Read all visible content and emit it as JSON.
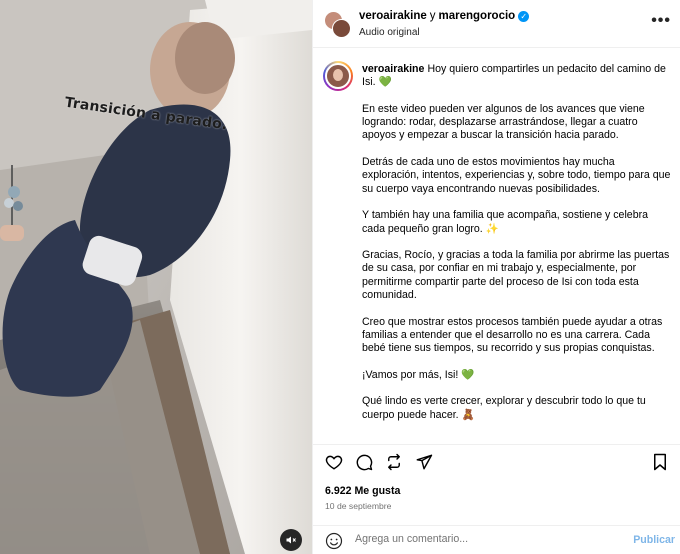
{
  "media": {
    "overlay_text": "Transición a parado."
  },
  "header": {
    "user1": "veroairakine",
    "conjunction": "y",
    "user2": "marengorocio",
    "audio": "Audio original",
    "more": "•••"
  },
  "caption": {
    "username": "veroairakine",
    "paragraphs": [
      "Hoy quiero compartirles un pedacito del camino de Isi. 💚",
      "En este video pueden ver algunos de los avances que viene logrando: rodar, desplazarse arrastrándose, llegar a cuatro apoyos y empezar a buscar la transición hacia parado.",
      "Detrás de cada uno de estos movimientos hay mucha exploración, intentos, experiencias y, sobre todo, tiempo para que su cuerpo vaya encontrando nuevas posibilidades.",
      "Y también hay una familia que acompaña, sostiene y celebra cada pequeño gran logro. ✨",
      "Gracias, Rocío, y gracias a toda la familia por abrirme las puertas de su casa, por confiar en mi trabajo y, especialmente, por permitirme compartir parte del proceso de Isi con toda esta comunidad.",
      "Creo que mostrar estos procesos también puede ayudar a otras familias a entender que el desarrollo no es una carrera. Cada bebé tiene sus tiempos, su recorrido y sus propias conquistas.",
      "¡Vamos por más, Isi! 💚",
      "Qué lindo es verte crecer, explorar y descubrir todo lo que tu cuerpo puede hacer. 🧸"
    ]
  },
  "stats": {
    "likes": "6.922 Me gusta",
    "date": "10 de septiembre"
  },
  "comment": {
    "placeholder": "Agrega un comentario...",
    "publish": "Publicar"
  },
  "colors": {
    "accent": "#0095f6",
    "publish_disabled": "#7fb6e8",
    "muted_text": "#737373"
  }
}
